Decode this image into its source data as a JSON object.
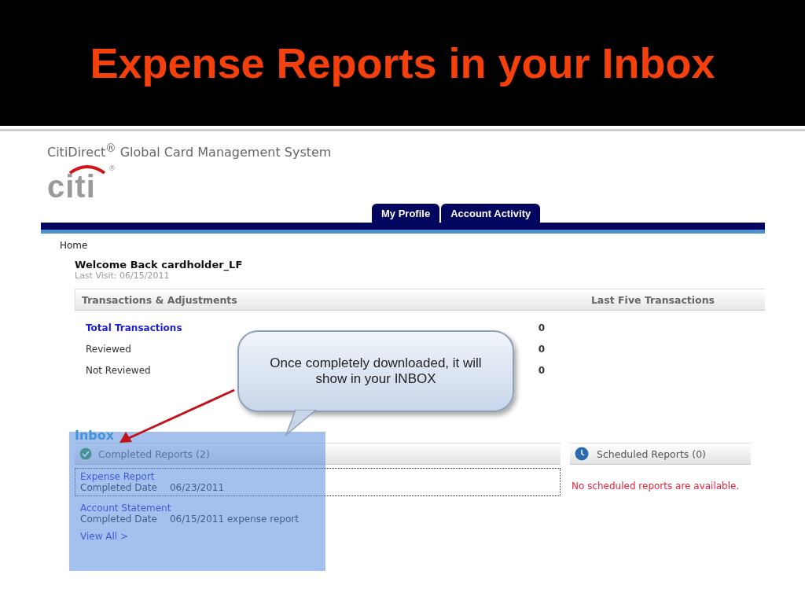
{
  "slide": {
    "title": "Expense Reports in your Inbox"
  },
  "app": {
    "title": "CitiDirect$^{®}$ Global Card Management System",
    "logo": {
      "text": "citi",
      "mark": "®"
    }
  },
  "tabs": [
    {
      "label": "My Profile",
      "selected": false
    },
    {
      "label": "Account Activity",
      "selected": false
    }
  ],
  "breadcrumb": "Home",
  "welcome": "Welcome Back cardholder_LF",
  "last_visit": "Last Visit: 06/15/2011",
  "transactions": {
    "header": "Transactions & Adjustments",
    "side_header": "Last Five Transactions",
    "rows": [
      {
        "label": "Total Transactions",
        "value": "0",
        "kind": "link"
      },
      {
        "label": "Reviewed",
        "value": "0",
        "kind": "plain"
      },
      {
        "label": "Not Reviewed",
        "value": "0",
        "kind": "plain"
      }
    ]
  },
  "callout": {
    "text": "Once completely downloaded, it will show in your INBOX"
  },
  "inbox": {
    "title": "Inbox",
    "completed_header": "Completed Reports (2)",
    "reports": [
      {
        "name": "Expense Report",
        "date_label": "Completed Date",
        "date": "06/23/2011",
        "selected": true
      },
      {
        "name": "Account Statement",
        "date_label": "Completed Date",
        "date": "06/15/2011 expense report",
        "selected": false
      }
    ],
    "view_all": "View All >",
    "scheduled_header": "Scheduled Reports (0)",
    "scheduled_empty": "No scheduled reports are available."
  }
}
